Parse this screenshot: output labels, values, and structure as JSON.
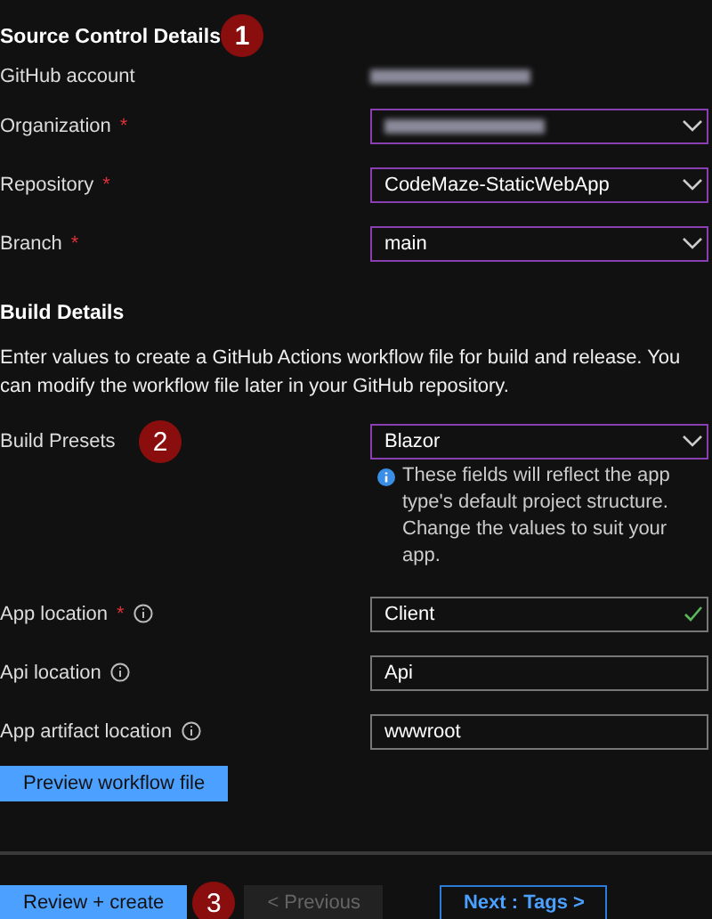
{
  "required_marker": "*",
  "source_control": {
    "title": "Source Control Details",
    "callout": "1",
    "account": {
      "label": "GitHub account",
      "blurred": true
    },
    "fields": [
      {
        "label": "Organization",
        "required": true,
        "kind": "select",
        "blurred": true
      },
      {
        "label": "Repository",
        "required": true,
        "kind": "select",
        "value": "CodeMaze-StaticWebApp",
        "blurred": false
      },
      {
        "label": "Branch",
        "required": true,
        "kind": "select",
        "value": "main",
        "blurred": false
      }
    ]
  },
  "build": {
    "title": "Build Details",
    "description": "Enter values to create a GitHub Actions workflow file for build and release. You can modify the workflow file later in your GitHub repository.",
    "presets": {
      "label": "Build Presets",
      "callout": "2",
      "value": "Blazor",
      "note": "These fields will reflect the app type's default project structure. Change the values to suit your app."
    },
    "fields": [
      {
        "label": "App location",
        "required": true,
        "info": true,
        "kind": "text",
        "value": "Client",
        "valid": true
      },
      {
        "label": "Api location",
        "required": false,
        "info": true,
        "kind": "text",
        "value": "Api",
        "valid": false
      },
      {
        "label": "App artifact location",
        "required": false,
        "info": true,
        "kind": "text",
        "value": "wwwroot",
        "valid": false
      }
    ],
    "preview_button": "Preview workflow file"
  },
  "footer": {
    "buttons": [
      {
        "label": "Review + create",
        "kind": "primary",
        "disabled": false,
        "callout": "3"
      },
      {
        "label": "< Previous",
        "kind": "secondary",
        "disabled": true
      },
      {
        "label": "Next : Tags >",
        "kind": "outline",
        "disabled": false
      }
    ]
  }
}
